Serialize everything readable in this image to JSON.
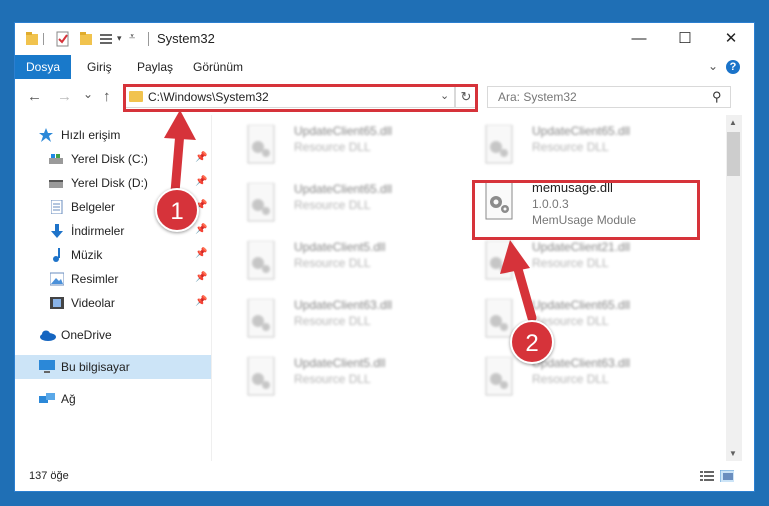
{
  "title": {
    "window_title": "System32",
    "minimize_glyph": "—",
    "maximize_glyph": "☐",
    "close_glyph": "✕"
  },
  "ribbon": {
    "tabs": [
      {
        "label": "Dosya"
      },
      {
        "label": "Giriş"
      },
      {
        "label": "Paylaş"
      },
      {
        "label": "Görünüm"
      }
    ],
    "help_glyph": "?"
  },
  "nav": {
    "back_glyph": "←",
    "forward_glyph": "→",
    "recent_glyph": "⌄",
    "up_glyph": "↑",
    "address": "C:\\Windows\\System32",
    "refresh_glyph": "↻",
    "search_placeholder": "Ara: System32"
  },
  "sidebar": {
    "items": [
      {
        "label": "Hızlı erişim",
        "icon": "star-icon",
        "pinned": false
      },
      {
        "label": "Yerel Disk (C:)",
        "icon": "drive-icon",
        "pinned": true
      },
      {
        "label": "Yerel Disk (D:)",
        "icon": "drive-icon",
        "pinned": true
      },
      {
        "label": "Belgeler",
        "icon": "documents-icon",
        "pinned": true
      },
      {
        "label": "İndirmeler",
        "icon": "download-icon",
        "pinned": true
      },
      {
        "label": "Müzik",
        "icon": "music-icon",
        "pinned": true
      },
      {
        "label": "Resimler",
        "icon": "pictures-icon",
        "pinned": true
      },
      {
        "label": "Videolar",
        "icon": "videos-icon",
        "pinned": true
      },
      {
        "label": "OneDrive",
        "icon": "cloud-icon",
        "pinned": false
      },
      {
        "label": "Bu bilgisayar",
        "icon": "computer-icon",
        "pinned": false
      },
      {
        "label": "Ağ",
        "icon": "network-icon",
        "pinned": false
      }
    ],
    "selected": "Bu bilgisayar"
  },
  "files": {
    "blurred": [
      {
        "name": "UpdateClient65.dll",
        "type": "Resource DLL"
      },
      {
        "name": "UpdateClient65.dll",
        "type": "Resource DLL"
      },
      {
        "name": "UpdateClient65.dll",
        "type": "Resource DLL"
      },
      {
        "name": "UpdateClient5.dll",
        "type": "Resource DLL"
      },
      {
        "name": "UpdateClient21.dll",
        "type": "Resource DLL"
      },
      {
        "name": "UpdateClient63.dll",
        "type": "Resource DLL"
      },
      {
        "name": "UpdateClient65.dll",
        "type": "Resource DLL"
      },
      {
        "name": "UpdateClient5.dll",
        "type": "Resource DLL"
      },
      {
        "name": "UpdateClient63.dll",
        "type": "Resource DLL"
      }
    ],
    "highlighted": {
      "name": "memusage.dll",
      "version": "1.0.0.3",
      "description": "MemUsage Module"
    }
  },
  "status": {
    "item_count": "137 öğe"
  },
  "annotations": {
    "step1": "1",
    "step2": "2",
    "accent_color": "#d6333a"
  }
}
